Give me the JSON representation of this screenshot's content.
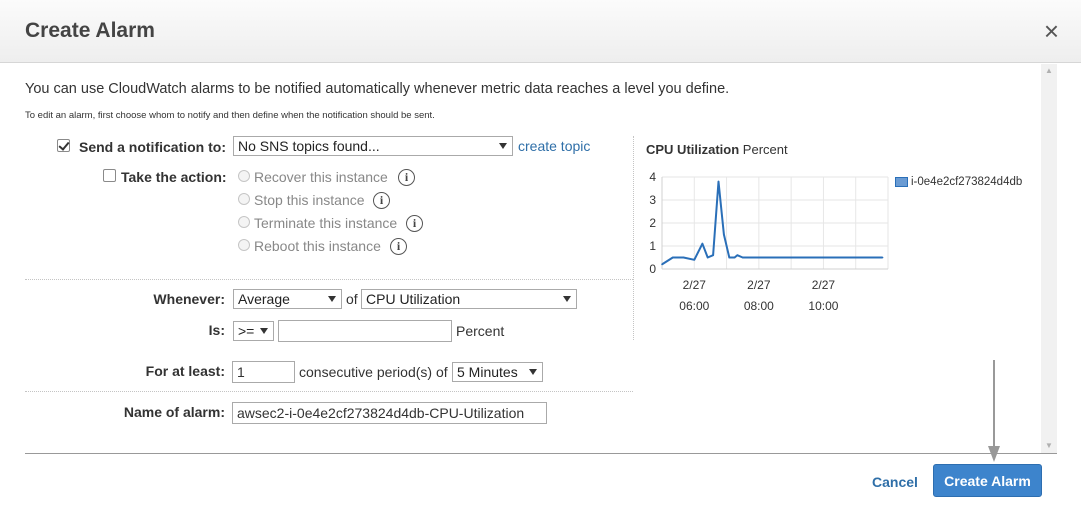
{
  "dialog": {
    "title": "Create Alarm",
    "close_icon": "×",
    "intro": "You can use CloudWatch alarms to be notified automatically whenever metric data reaches a level you define.",
    "sub": "To edit an alarm, first choose whom to notify and then define when the notification should be sent."
  },
  "notification": {
    "checked": true,
    "label": "Send a notification to:",
    "select_value": "No SNS topics found...",
    "create_topic_link": "create topic"
  },
  "action": {
    "checked": false,
    "label": "Take the action:",
    "options": [
      "Recover this instance",
      "Stop this instance",
      "Terminate this instance",
      "Reboot this instance"
    ],
    "info_icon": "i"
  },
  "condition": {
    "whenever_label": "Whenever:",
    "statistic": "Average",
    "of_label": "of",
    "metric": "CPU Utilization",
    "is_label": "Is:",
    "operator": ">=",
    "threshold_value": "",
    "unit_label": "Percent",
    "for_at_least_label": "For at least:",
    "periods": "1",
    "consecutive_label": "consecutive period(s) of",
    "period_length": "5 Minutes",
    "name_label": "Name of alarm:",
    "name_value": "awsec2-i-0e4e2cf273824d4db-CPU-Utilization"
  },
  "chart_data": {
    "type": "line",
    "title": "CPU Utilization",
    "unit": "Percent",
    "series": [
      {
        "name": "i-0e4e2cf273824d4db",
        "color": "#2a6fb8",
        "x": [
          "02/27 05:00",
          "02/27 05:20",
          "02/27 05:40",
          "02/27 06:00",
          "02/27 06:15",
          "02/27 06:25",
          "02/27 06:35",
          "02/27 06:45",
          "02/27 06:55",
          "02/27 07:05",
          "02/27 07:15",
          "02/27 07:20",
          "02/27 07:30",
          "02/27 07:45",
          "02/27 08:00",
          "02/27 09:00",
          "02/27 10:00",
          "02/27 11:00",
          "02/27 11:50"
        ],
        "values": [
          0.2,
          0.5,
          0.5,
          0.4,
          1.1,
          0.5,
          0.6,
          3.8,
          1.5,
          0.5,
          0.5,
          0.6,
          0.5,
          0.5,
          0.5,
          0.5,
          0.5,
          0.5,
          0.5
        ]
      }
    ],
    "ylim": [
      0,
      4
    ],
    "yticks": [
      "0",
      "1",
      "2",
      "3",
      "4"
    ],
    "xticks": [
      {
        "date": "2/27",
        "time": "06:00"
      },
      {
        "date": "2/27",
        "time": "08:00"
      },
      {
        "date": "2/27",
        "time": "10:00"
      }
    ],
    "grid": true,
    "legend": "right"
  },
  "buttons": {
    "cancel": "Cancel",
    "create": "Create Alarm"
  }
}
